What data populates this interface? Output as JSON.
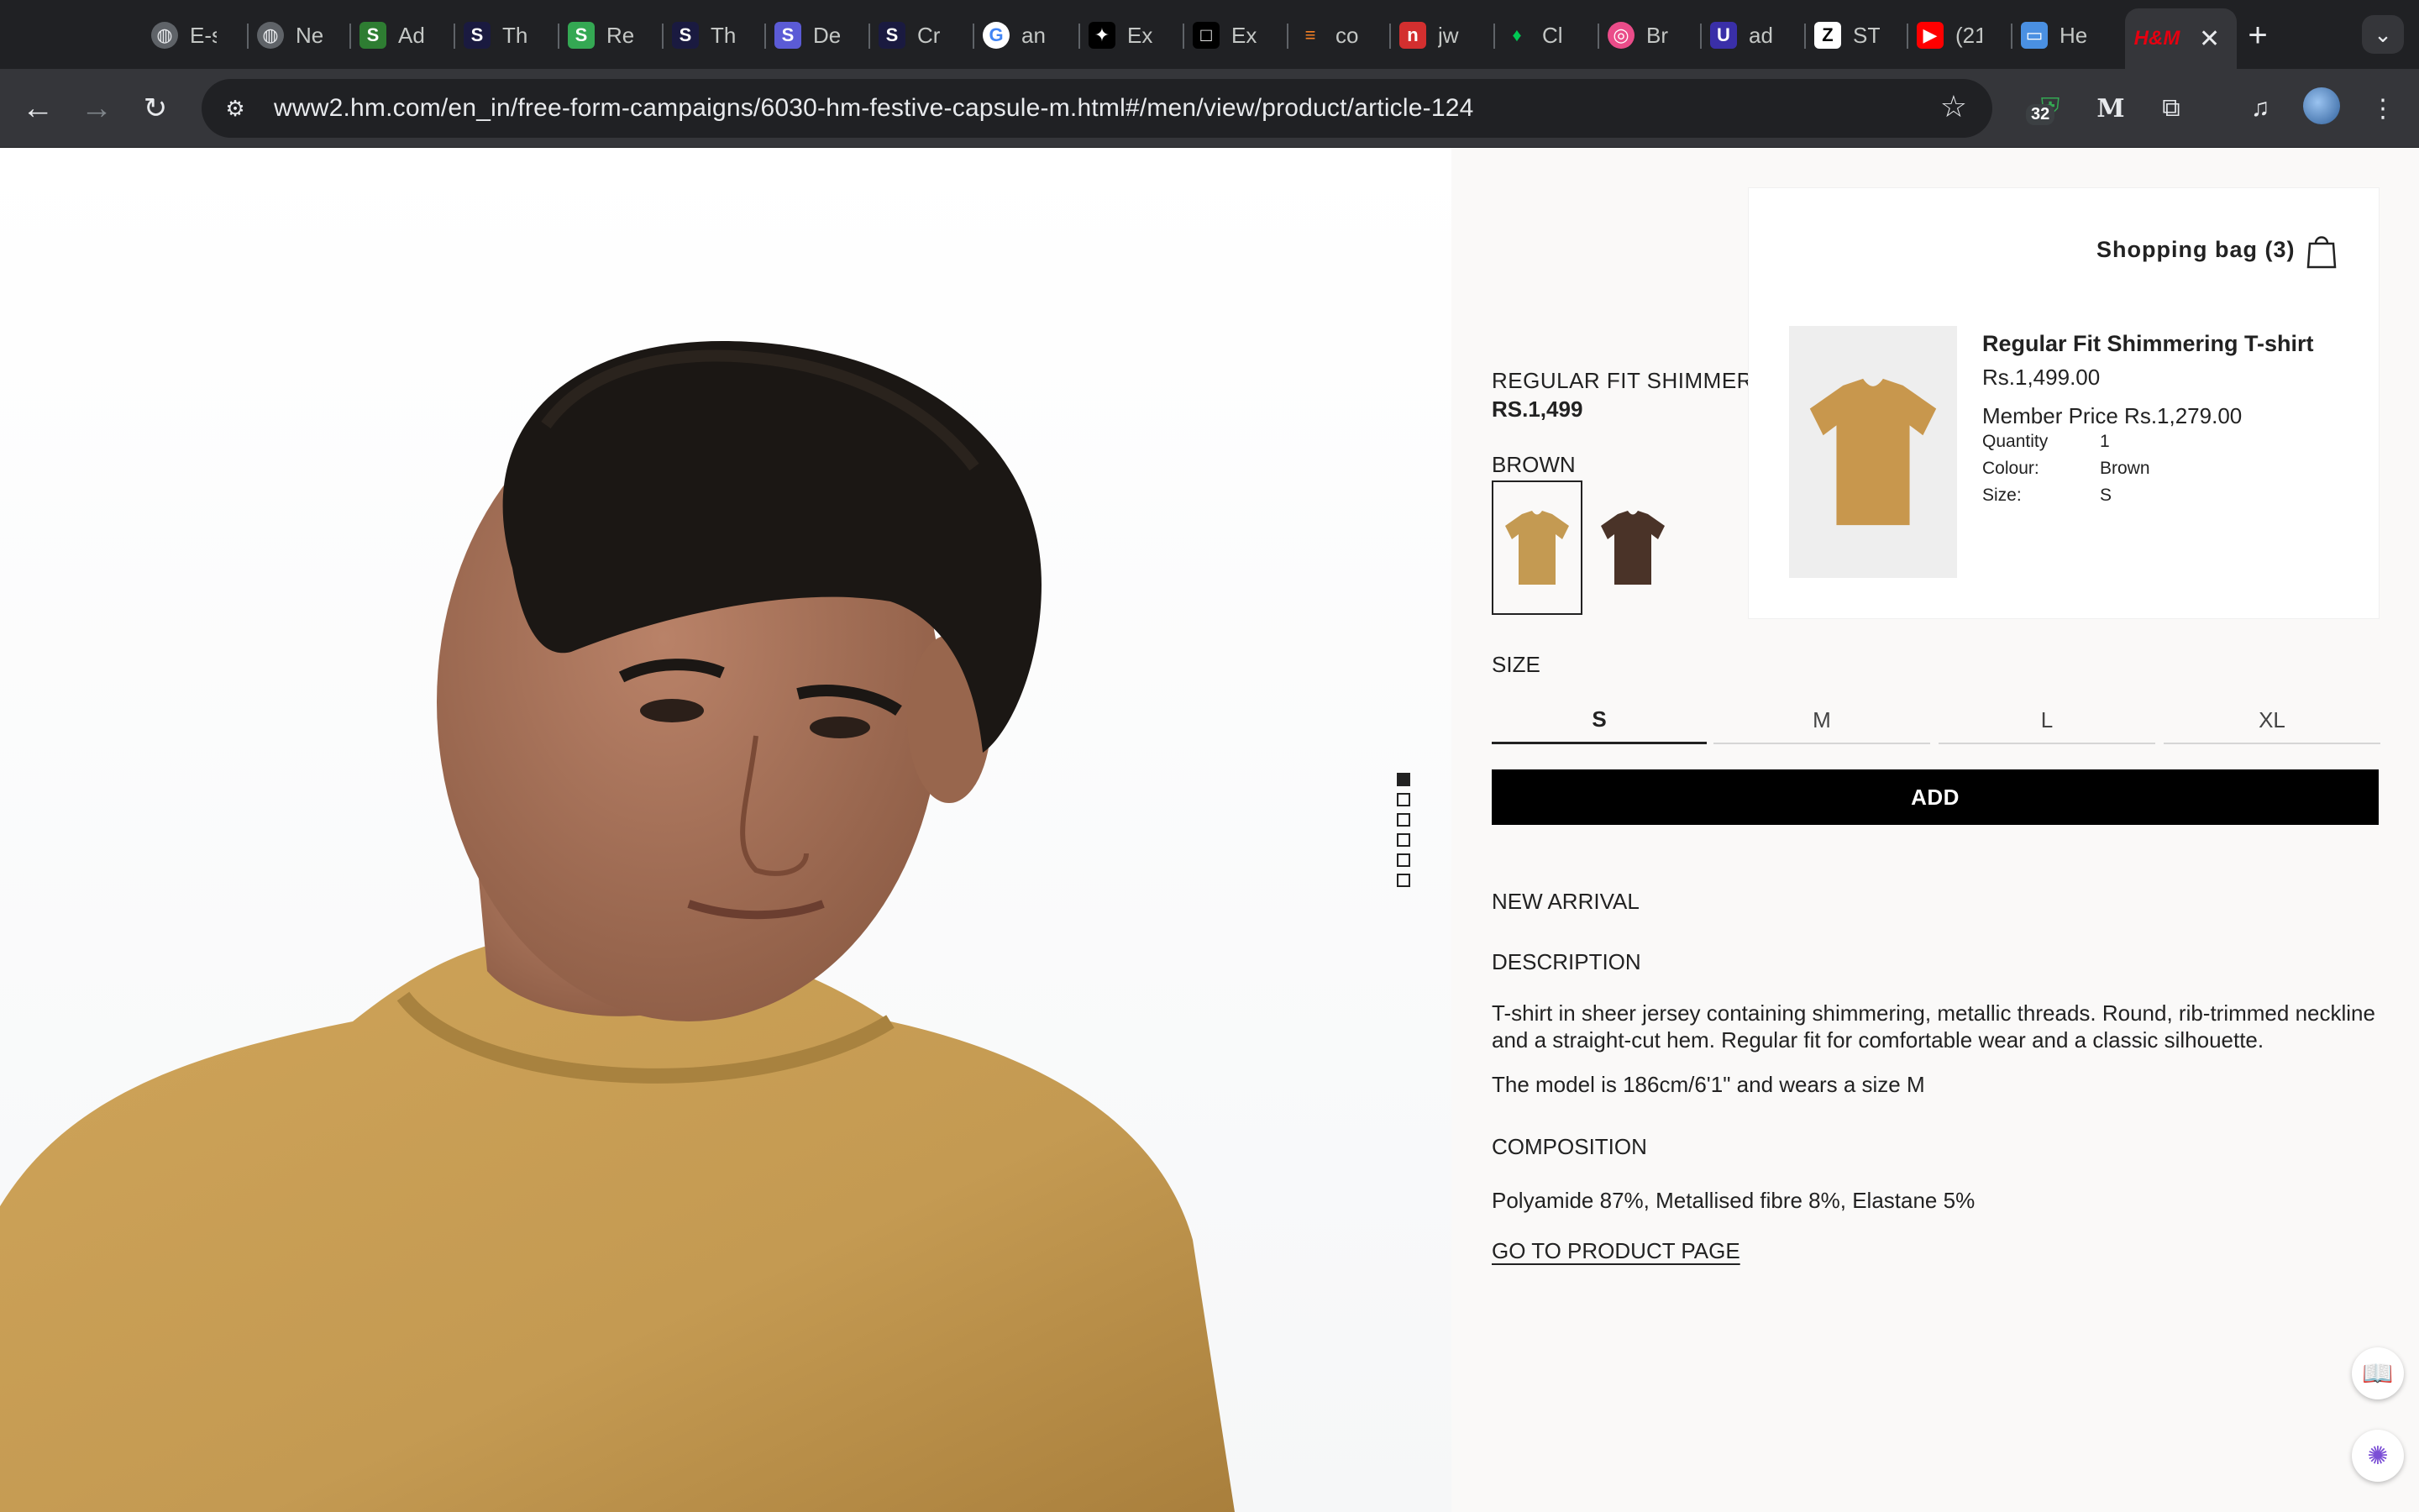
{
  "browser": {
    "tabs": [
      {
        "title": "E-s",
        "icon": "globe-icon",
        "color": "#5f6368"
      },
      {
        "title": "Ne",
        "icon": "globe-icon",
        "color": "#5f6368"
      },
      {
        "title": "Ad",
        "icon": "s-badge-icon",
        "color": "#2e7d32"
      },
      {
        "title": "Th",
        "icon": "s-badge-icon",
        "color": "#1a1a40"
      },
      {
        "title": "Re",
        "icon": "s-badge-icon",
        "color": "#34a853"
      },
      {
        "title": "Th",
        "icon": "s-badge-icon",
        "color": "#1a1a40"
      },
      {
        "title": "De",
        "icon": "s-badge-icon",
        "color": "#5b5bd6"
      },
      {
        "title": "Cr",
        "icon": "s-badge-icon",
        "color": "#1a1a40"
      },
      {
        "title": "an",
        "icon": "google-icon",
        "color": "#ffffff"
      },
      {
        "title": "Ex",
        "icon": "figma-icon",
        "color": "#000000"
      },
      {
        "title": "Ex",
        "icon": "square-icon",
        "color": "#000000"
      },
      {
        "title": "co",
        "icon": "stackoverflow-icon",
        "color": "#f48024"
      },
      {
        "title": "jw",
        "icon": "n-icon",
        "color": "#d32f2f"
      },
      {
        "title": "Cl",
        "icon": "leaf-icon",
        "color": "#00c853"
      },
      {
        "title": "Br",
        "icon": "dribbble-icon",
        "color": "#ea4c89"
      },
      {
        "title": "ad",
        "icon": "ui-icon",
        "color": "#3a2fa8"
      },
      {
        "title": "ST",
        "icon": "zara-icon",
        "color": "#ffffff"
      },
      {
        "title": "(21",
        "icon": "youtube-icon",
        "color": "#ff0000"
      },
      {
        "title": "He",
        "icon": "chat-icon",
        "color": "#4a90e2"
      }
    ],
    "active_tab": {
      "icon": "hm-icon",
      "logo_text": "H&M",
      "color": "#e50010"
    },
    "url": "www2.hm.com/en_in/free-form-campaigns/6030-hm-festive-capsule-m.html#/men/view/product/article-124",
    "extension_badge": "32"
  },
  "product": {
    "name": "REGULAR FIT SHIMMERING T-SHIRT",
    "price": "RS.1,499",
    "color_label": "BROWN",
    "swatches": [
      {
        "name": "Brown",
        "color": "#c49a52",
        "selected": true
      },
      {
        "name": "Dark brown",
        "color": "#4a3328",
        "selected": false
      }
    ],
    "size_label": "SIZE",
    "sizes": [
      {
        "label": "S",
        "selected": true
      },
      {
        "label": "M",
        "selected": false
      },
      {
        "label": "L",
        "selected": false
      },
      {
        "label": "XL",
        "selected": false
      }
    ],
    "add_label": "ADD",
    "new_arrival": "NEW ARRIVAL",
    "description_heading": "DESCRIPTION",
    "description": "T-shirt in sheer jersey containing shimmering, metallic threads. Round, rib-trimmed neckline and a straight-cut hem. Regular fit for comfortable wear and a classic silhouette.",
    "model_info": "The model is 186cm/6'1\" and wears a size M",
    "composition_heading": "COMPOSITION",
    "composition": "Polyamide 87%, Metallised fibre 8%, Elastane 5%",
    "product_page_link": "GO TO PRODUCT PAGE",
    "image_count": 6,
    "image_index": 1
  },
  "bag": {
    "title": "Shopping bag (3)",
    "item": {
      "name": "Regular Fit Shimmering T-shirt",
      "price": "Rs.1,499.00",
      "member_price": "Member Price Rs.1,279.00",
      "quantity_label": "Quantity",
      "quantity": "1",
      "colour_label": "Colour:",
      "colour": "Brown",
      "size_label": "Size:",
      "size": "S"
    }
  },
  "colors": {
    "shirt": "#c49a52",
    "hair": "#1b1714",
    "skin": "#a8735a",
    "brand_red": "#e50010"
  }
}
